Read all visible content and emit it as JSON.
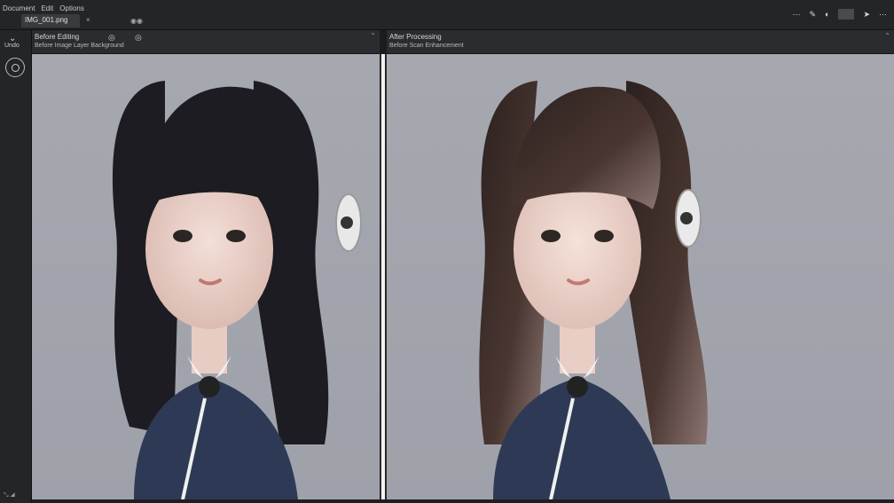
{
  "menu": [
    "Document",
    "Edit",
    "Options"
  ],
  "tab": {
    "label": "IMG_001.png"
  },
  "topbar": {
    "tab_close": "×",
    "extra": "◉◉",
    "icons": [
      "⋯",
      "✎",
      "◐",
      "▭",
      "➤",
      "⋯"
    ]
  },
  "toolbar": {
    "chevron": "⌄",
    "label": "Undo",
    "bottom": "⤡ ◢"
  },
  "panels": {
    "left": {
      "title": "Before Editing",
      "subtitle": "Before Image Layer Background",
      "icon1": "◎",
      "icon2": "◎",
      "corner": "⌃"
    },
    "right": {
      "title": "After Processing",
      "subtitle": "Before Scan Enhancement",
      "corner": "⌃"
    }
  },
  "colors": {
    "background": "#a6a8b0",
    "hair_left": "#1d1c22",
    "hair_right": "#4a3630",
    "sweater": "#2e3a55"
  }
}
